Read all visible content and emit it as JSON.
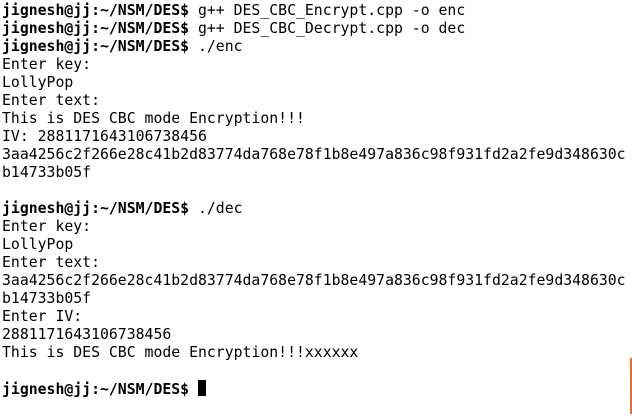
{
  "terminal": {
    "lines": [
      {
        "type": "cmd",
        "prompt": "jignesh@jj:~/NSM/DES$",
        "command": " g++ DES_CBC_Encrypt.cpp -o enc"
      },
      {
        "type": "cmd",
        "prompt": "jignesh@jj:~/NSM/DES$",
        "command": " g++ DES_CBC_Decrypt.cpp -o dec"
      },
      {
        "type": "cmd",
        "prompt": "jignesh@jj:~/NSM/DES$",
        "command": " ./enc"
      },
      {
        "type": "out",
        "text": "Enter key:"
      },
      {
        "type": "out",
        "text": "LollyPop"
      },
      {
        "type": "out",
        "text": "Enter text:"
      },
      {
        "type": "out",
        "text": "This is DES CBC mode Encryption!!!"
      },
      {
        "type": "out",
        "text": "IV: 2881171643106738456"
      },
      {
        "type": "out",
        "text": "3aa4256c2f266e28c41b2d83774da768e78f1b8e497a836c98f931fd2a2fe9d348630c"
      },
      {
        "type": "out",
        "text": "b14733b05f"
      },
      {
        "type": "out",
        "text": ""
      },
      {
        "type": "cmd",
        "prompt": "jignesh@jj:~/NSM/DES$",
        "command": " ./dec"
      },
      {
        "type": "out",
        "text": "Enter key:"
      },
      {
        "type": "out",
        "text": "LollyPop"
      },
      {
        "type": "out",
        "text": "Enter text:"
      },
      {
        "type": "out",
        "text": "3aa4256c2f266e28c41b2d83774da768e78f1b8e497a836c98f931fd2a2fe9d348630c"
      },
      {
        "type": "out",
        "text": "b14733b05f"
      },
      {
        "type": "out",
        "text": "Enter IV:"
      },
      {
        "type": "out",
        "text": "2881171643106738456"
      },
      {
        "type": "out",
        "text": "This is DES CBC mode Encryption!!!xxxxxx"
      },
      {
        "type": "out",
        "text": ""
      },
      {
        "type": "cmd",
        "prompt": "jignesh@jj:~/NSM/DES$",
        "command": " ",
        "cursor": true
      }
    ]
  },
  "colors": {
    "background": "#ffffff",
    "text": "#000000",
    "cursor": "#000000",
    "scroll_indicator": "#e76f2b"
  }
}
